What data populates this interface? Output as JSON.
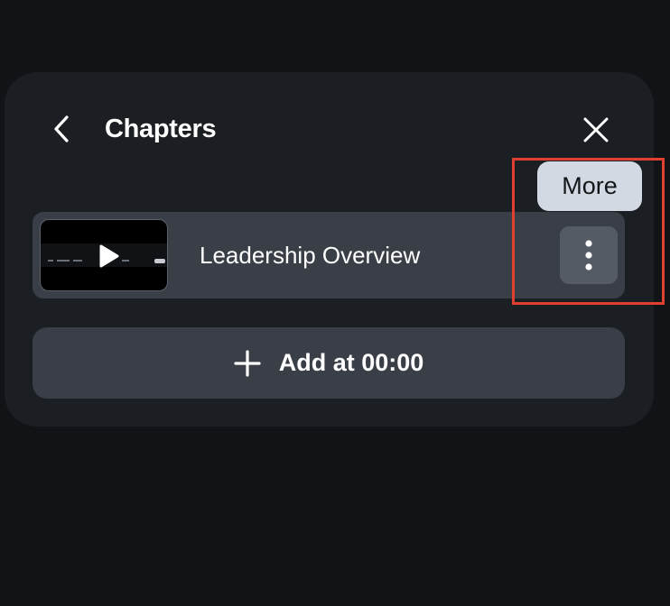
{
  "header": {
    "title": "Chapters",
    "back_icon": "chevron-left-icon",
    "close_icon": "close-icon"
  },
  "tooltip": {
    "label": "More"
  },
  "chapters": [
    {
      "name": "Leadership Overview",
      "thumbnail_icon": "play-icon",
      "more_icon": "more-vertical-icon"
    }
  ],
  "add_button": {
    "label": "Add at 00:00",
    "icon": "plus-icon"
  },
  "colors": {
    "background": "#111417",
    "panel": "#1b1e22",
    "row": "#393e47",
    "more_button": "#555b65",
    "tooltip": "#d3d9e2",
    "highlight": "#e0402f"
  }
}
